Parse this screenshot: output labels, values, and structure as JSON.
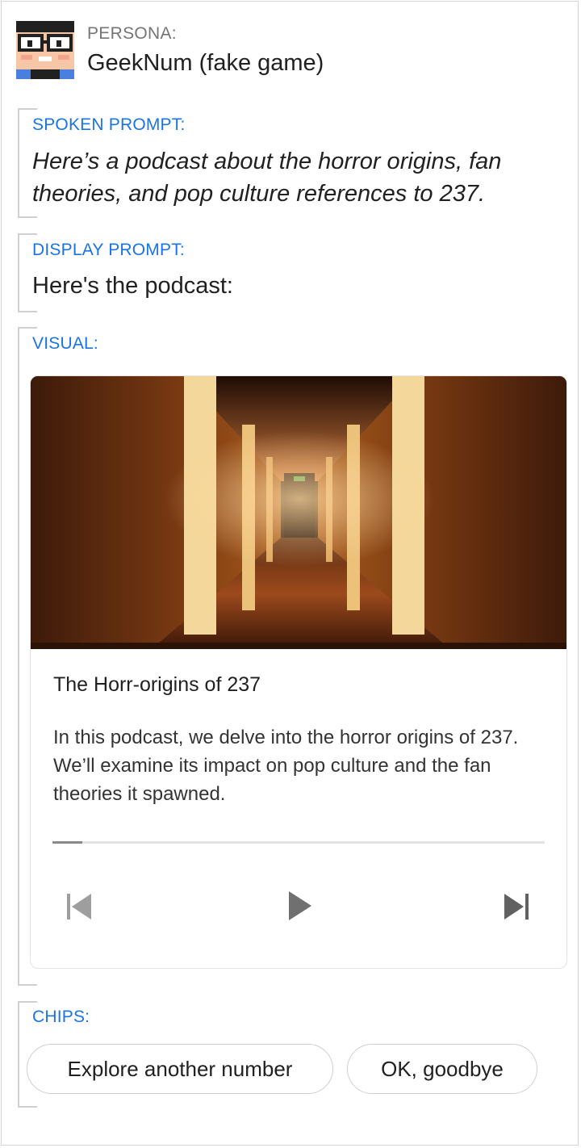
{
  "persona": {
    "label": "PERSONA:",
    "name": "GeekNum (fake game)",
    "avatar_icon": "geek-avatar-icon"
  },
  "spoken_prompt": {
    "label": "SPOKEN PROMPT:",
    "text": "Here’s a podcast about the horror origins, fan theories, and pop culture references to 237."
  },
  "display_prompt": {
    "label": "DISPLAY PROMPT:",
    "text": "Here's the podcast:"
  },
  "visual": {
    "label": "VISUAL:",
    "card": {
      "title": "The Horr-origins of 237",
      "description": "In this podcast, we delve into the horror origins of 237. We’ll examine its impact on pop culture and the fan theories it spawned.",
      "progress": 0.06,
      "controls": [
        "skip-previous-icon",
        "play-icon",
        "skip-next-icon"
      ]
    }
  },
  "chips": {
    "label": "CHIPS:",
    "items": [
      "Explore another number",
      "OK, goodbye"
    ]
  },
  "colors": {
    "section_label": "#1a73e8",
    "bracket": "#d0d0d0",
    "control_icon": "#8a8a8a"
  }
}
